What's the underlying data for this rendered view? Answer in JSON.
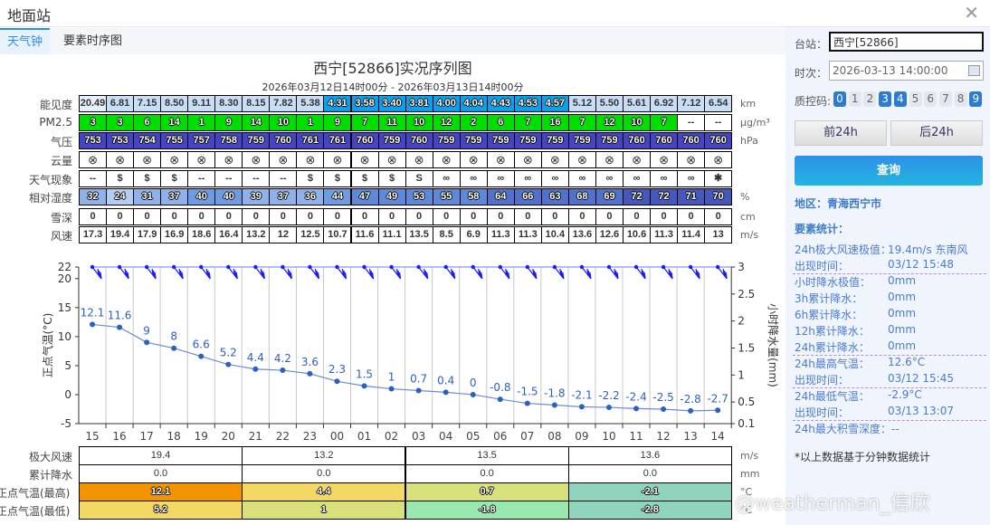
{
  "window": {
    "title": "地面站",
    "close_icon": "close-icon"
  },
  "tabs": [
    {
      "label": "天气钟",
      "active": true
    },
    {
      "label": "要素时序图",
      "active": false
    }
  ],
  "chart_title": "西宁[52866]实况序列图",
  "chart_subtitle": "2026年03月12日14时00分 - 2026年03月13日14时00分",
  "table": {
    "rows": [
      {
        "label": "能见度",
        "unit": "km",
        "values": [
          "20.49",
          "6.81",
          "7.15",
          "8.50",
          "9.11",
          "8.30",
          "8.15",
          "7.82",
          "5.38",
          "4.31",
          "3.58",
          "3.40",
          "3.81",
          "4.00",
          "4.04",
          "4.43",
          "4.53",
          "4.57",
          "5.12",
          "5.50",
          "5.61",
          "6.92",
          "7.12",
          "6.54"
        ]
      },
      {
        "label": "PM2.5",
        "unit": "μg/m³",
        "values": [
          "3",
          "3",
          "6",
          "14",
          "1",
          "9",
          "14",
          "10",
          "1",
          "9",
          "7",
          "11",
          "10",
          "12",
          "2",
          "6",
          "7",
          "16",
          "7",
          "12",
          "10",
          "7",
          "--",
          "--"
        ]
      },
      {
        "label": "气压",
        "unit": "hPa",
        "values": [
          "753",
          "753",
          "754",
          "755",
          "757",
          "758",
          "759",
          "760",
          "761",
          "761",
          "760",
          "759",
          "760",
          "759",
          "759",
          "759",
          "759",
          "759",
          "759",
          "759",
          "760",
          "760",
          "760",
          "760"
        ]
      },
      {
        "label": "云量",
        "unit": "",
        "values": [
          "⊗",
          "⊗",
          "⊗",
          "⊗",
          "⊗",
          "⊗",
          "⊗",
          "⊗",
          "⊗",
          "⊗",
          "⊗",
          "⊗",
          "⊗",
          "⊗",
          "⊗",
          "⊗",
          "⊗",
          "⊗",
          "⊗",
          "⊗",
          "⊗",
          "⊗",
          "⊗",
          "⊗"
        ]
      },
      {
        "label": "天气现象",
        "unit": "",
        "values": [
          "--",
          "$",
          "$",
          "$",
          "--",
          "--",
          "--",
          "--",
          "$",
          "$",
          "$",
          "$",
          "S",
          "∞",
          "∞",
          "∞",
          "∞",
          "∞",
          "∞",
          "∞",
          "∞",
          "∞",
          "∞",
          "✱"
        ]
      },
      {
        "label": "相对湿度",
        "unit": "%",
        "values": [
          "32",
          "24",
          "31",
          "37",
          "40",
          "40",
          "39",
          "37",
          "36",
          "44",
          "47",
          "49",
          "53",
          "55",
          "58",
          "64",
          "66",
          "63",
          "68",
          "69",
          "72",
          "72",
          "71",
          "70"
        ]
      },
      {
        "label": "雪深",
        "unit": "cm",
        "values": [
          "0",
          "0",
          "0",
          "0",
          "0",
          "0",
          "0",
          "0",
          "0",
          "0",
          "0",
          "0",
          "0",
          "0",
          "0",
          "0",
          "0",
          "0",
          "0",
          "0",
          "0",
          "0",
          "0",
          "0"
        ]
      },
      {
        "label": "风速",
        "unit": "m/s",
        "values": [
          "17.3",
          "19.4",
          "17.9",
          "16.9",
          "18.6",
          "16.4",
          "13.2",
          "12",
          "12.5",
          "10.7",
          "11.6",
          "11.1",
          "13.5",
          "8.5",
          "6.9",
          "11.3",
          "11.3",
          "10.4",
          "13.6",
          "12.6",
          "10.6",
          "11.3",
          "11.4",
          "13"
        ]
      }
    ]
  },
  "colors": {
    "pm25": "#00dd00",
    "pressure": "#4444c4",
    "vis_high": "#c8def6",
    "vis_low": "#0aa0ee",
    "line": "#2c5fc4",
    "barb": "#1a1aff"
  },
  "chart_data": {
    "type": "line",
    "categories": [
      "15",
      "16",
      "17",
      "18",
      "19",
      "20",
      "21",
      "22",
      "23",
      "00",
      "01",
      "02",
      "03",
      "04",
      "05",
      "06",
      "07",
      "08",
      "09",
      "10",
      "11",
      "12",
      "13",
      "14"
    ],
    "series": [
      {
        "values": [
          12.1,
          11.6,
          9,
          8,
          6.6,
          5.2,
          4.4,
          4.2,
          3.6,
          2.3,
          1.5,
          1,
          0.7,
          0.4,
          0,
          -0.8,
          -1.5,
          -1.8,
          -2.1,
          -2.2,
          -2.4,
          -2.5,
          -2.8,
          -2.7
        ]
      }
    ],
    "ylabel": "正点气温(°C)",
    "y2label": "小时降水量(mm)",
    "ylim": [
      -5,
      22
    ],
    "yticks": [
      "-5",
      "0",
      "5",
      "10",
      "15",
      "20",
      "22"
    ],
    "y2lim": [
      0.1,
      3
    ],
    "y2ticks": [
      "0.1",
      "0.5",
      "1",
      "1.5",
      "2",
      "2.5",
      "3"
    ],
    "grid": "vertical"
  },
  "summary": {
    "rows": [
      {
        "label": "极大风速",
        "unit": "m/s",
        "values": [
          "19.4",
          "13.2",
          "13.5",
          "13.6"
        ],
        "colors": [
          "#fff",
          "#fff",
          "#fff",
          "#fff"
        ]
      },
      {
        "label": "累计降水",
        "unit": "mm",
        "values": [
          "0.0",
          "0.0",
          "0.0",
          "0.0"
        ],
        "colors": [
          "#fff",
          "#fff",
          "#fff",
          "#fff"
        ]
      },
      {
        "label": "正点气温(最高)",
        "unit": "°C",
        "values": [
          "12.1",
          "4.4",
          "0.7",
          "-2.1"
        ],
        "colors": [
          "#f29400",
          "#f3d964",
          "#d8e07c",
          "#90d4be"
        ]
      },
      {
        "label": "正点气温(最低)",
        "unit": "°C",
        "values": [
          "5.2",
          "1",
          "-1.8",
          "-2.8"
        ],
        "colors": [
          "#f3d964",
          "#d8e07c",
          "#98e8b0",
          "#90d4be"
        ]
      }
    ]
  },
  "panel": {
    "station_label": "台站：",
    "station_value": "西宁[52866]",
    "time_label": "时次：",
    "time_value": "2026-03-13 14:00:00",
    "qc_label": "质控码:",
    "qc_codes": [
      {
        "c": "0",
        "on": true
      },
      {
        "c": "1",
        "on": false
      },
      {
        "c": "2",
        "on": false
      },
      {
        "c": "3",
        "on": true
      },
      {
        "c": "4",
        "on": true
      },
      {
        "c": "5",
        "on": false
      },
      {
        "c": "6",
        "on": false
      },
      {
        "c": "7",
        "on": false
      },
      {
        "c": "8",
        "on": false
      },
      {
        "c": "9",
        "on": true
      }
    ],
    "prev_btn": "前24h",
    "next_btn": "后24h",
    "query_btn": "查询",
    "region": "地区：青海西宁市",
    "stats_title": "要素统计：",
    "stats": [
      {
        "k": "24h极大风速极值：",
        "v": "19.4m/s 东南风"
      },
      {
        "k": "出现时间：",
        "v": "03/12 15:48"
      },
      {
        "k": "小时降水极值：",
        "v": "0mm"
      },
      {
        "k": "3h累计降水：",
        "v": "0mm"
      },
      {
        "k": "6h累计降水：",
        "v": "0mm"
      },
      {
        "k": "12h累计降水：",
        "v": "0mm"
      },
      {
        "k": "24h累计降水：",
        "v": "0mm"
      },
      {
        "k": "24h最高气温：",
        "v": "12.6°C"
      },
      {
        "k": "出现时间：",
        "v": "03/12 15:45"
      },
      {
        "k": "24h最低气温：",
        "v": "-2.9°C"
      },
      {
        "k": "出现时间：",
        "v": "03/13 13:07"
      },
      {
        "k": "24h最大积雪深度：",
        "v": "--"
      }
    ],
    "note": "*以上数据基于分钟数据统计"
  },
  "watermark": "@weatherman_信欣"
}
